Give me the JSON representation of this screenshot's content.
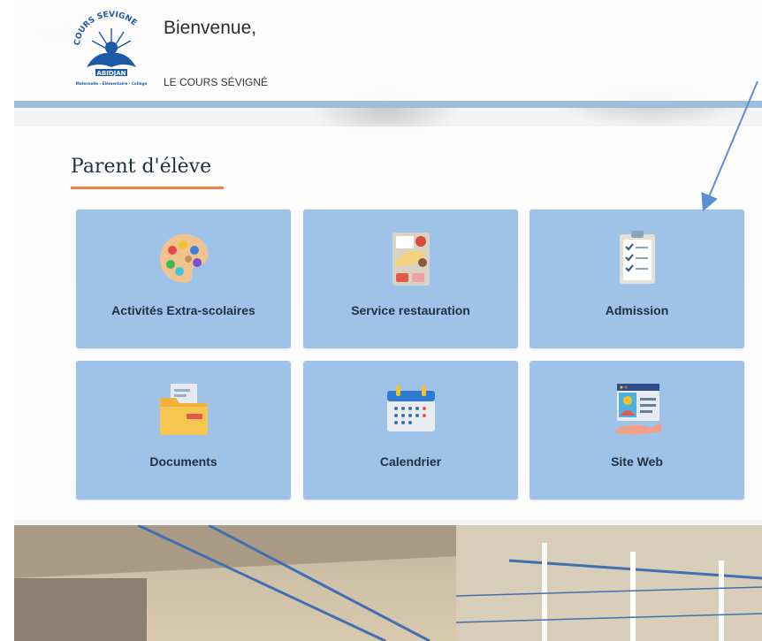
{
  "header": {
    "welcome": "Bienvenue,",
    "school_name": "LE COURS SÉVIGNÉ",
    "logo": {
      "top_text": "COURS SEVIGNE",
      "city": "ABIDJAN",
      "subtitle": "Maternelle - Élémentaire - Collège"
    }
  },
  "section": {
    "title": "Parent d'élève"
  },
  "tiles": [
    {
      "label": "Activités Extra-scolaires",
      "icon": "palette-icon"
    },
    {
      "label": "Service restauration",
      "icon": "meal-tray-icon"
    },
    {
      "label": "Admission",
      "icon": "checklist-clipboard-icon"
    },
    {
      "label": "Documents",
      "icon": "folder-icon"
    },
    {
      "label": "Calendrier",
      "icon": "calendar-icon"
    },
    {
      "label": "Site Web",
      "icon": "website-profile-icon"
    }
  ],
  "colors": {
    "tile_bg": "#9fc3e8",
    "accent_underline": "#e8824a",
    "header_bar": "#9fbddb",
    "annotation_arrow": "#5b8fd0"
  }
}
